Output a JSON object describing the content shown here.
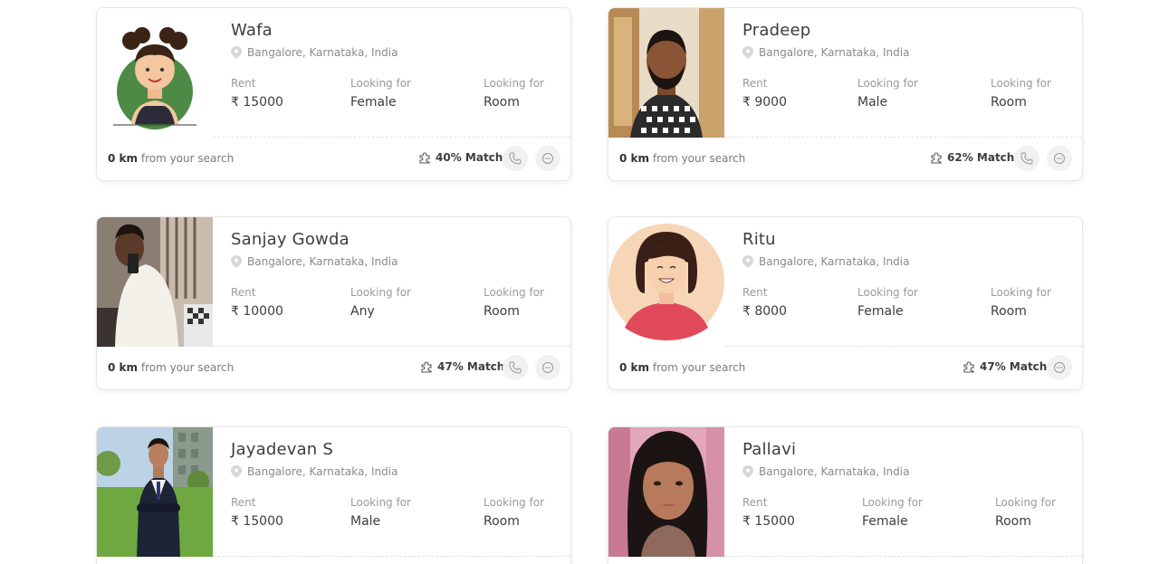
{
  "labels": {
    "rent": "Rent",
    "looking_for": "Looking for",
    "from_search": "from your search",
    "match_suffix": "Match"
  },
  "cards": [
    {
      "name": "Wafa",
      "location": "Bangalore, Karnataka, India",
      "rent": "₹ 15000",
      "gender": "Female",
      "type": "Room",
      "distance": "0 km",
      "match": "40% Match",
      "photo": "avatar-girl-illustration"
    },
    {
      "name": "Pradeep",
      "location": "Bangalore, Karnataka, India",
      "rent": "₹ 9000",
      "gender": "Male",
      "type": "Room",
      "distance": "0 km",
      "match": "62% Match",
      "photo": "man-checkered-shirt-photo"
    },
    {
      "name": "Sanjay Gowda",
      "location": "Bangalore, Karnataka, India",
      "rent": "₹ 10000",
      "gender": "Any",
      "type": "Room",
      "distance": "0 km",
      "match": "47% Match",
      "photo": "mirror-selfie-photo"
    },
    {
      "name": "Ritu",
      "location": "Bangalore, Karnataka, India",
      "rent": "₹ 8000",
      "gender": "Female",
      "type": "Room",
      "distance": "0 km",
      "match": "47% Match",
      "photo": "avatar-woman-illustration"
    },
    {
      "name": "Jayadevan S",
      "location": "Bangalore, Karnataka, India",
      "rent": "₹ 15000",
      "gender": "Male",
      "type": "Room",
      "distance": "",
      "match": "",
      "photo": "man-suit-photo"
    },
    {
      "name": "Pallavi",
      "location": "Bangalore, Karnataka, India",
      "rent": "₹ 15000",
      "gender": "Female",
      "type": "Room",
      "distance": "",
      "match": "",
      "photo": "woman-portrait-photo"
    }
  ],
  "colors": {
    "card_border": "#e6e6e6",
    "text_primary": "#3d3d3d",
    "text_muted": "#8a8a8a",
    "icon_bg": "#f1f1f1"
  }
}
